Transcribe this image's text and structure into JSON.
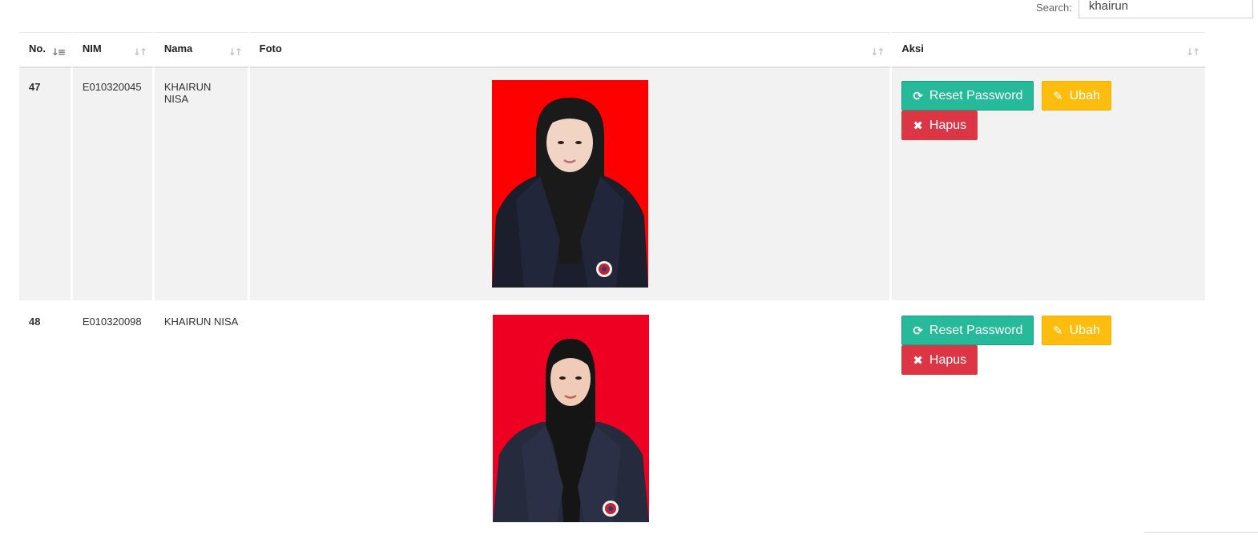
{
  "search": {
    "label": "Search:",
    "value": "khairun"
  },
  "table": {
    "headers": {
      "no": "No.",
      "nim": "NIM",
      "nama": "Nama",
      "foto": "Foto",
      "aksi": "Aksi"
    },
    "rows": [
      {
        "no": "47",
        "nim": "E010320045",
        "nama": "KHAIRUN NISA",
        "photo_bg": "#ff0000"
      },
      {
        "no": "48",
        "nim": "E010320098",
        "nama": "KHAIRUN NISA",
        "photo_bg": "#ee0022"
      }
    ]
  },
  "actions": {
    "reset_label": "Reset Password",
    "ubah_label": "Ubah",
    "hapus_label": "Hapus",
    "reset_icon": "refresh-icon",
    "ubah_icon": "edit-icon",
    "hapus_icon": "close-icon"
  },
  "colors": {
    "reset": "#26b99a",
    "ubah": "#fcbd0e",
    "hapus": "#dc3545",
    "row_stripe": "#f2f2f2"
  }
}
